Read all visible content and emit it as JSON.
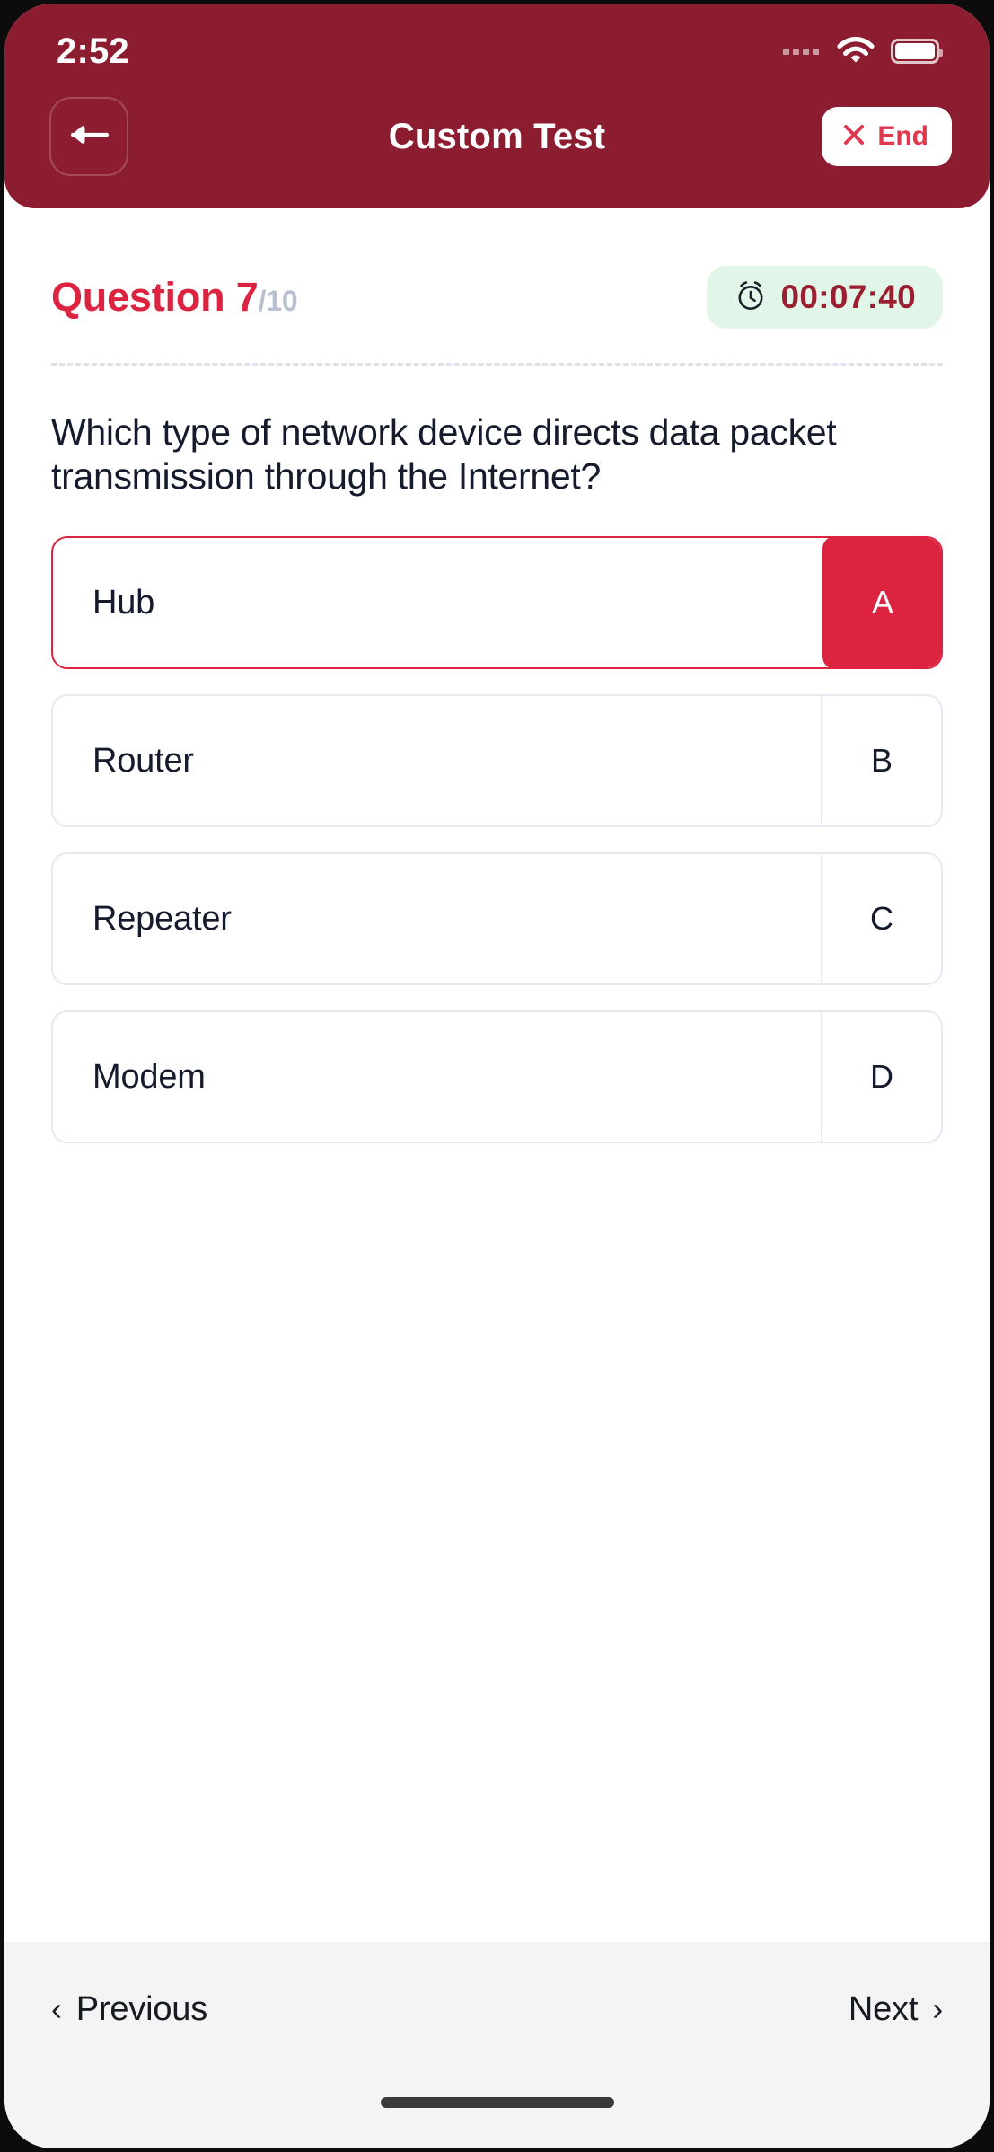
{
  "statusbar": {
    "time": "2:52",
    "signal_icon": "signal-dots-icon",
    "wifi_icon": "wifi-icon",
    "battery_icon": "battery-icon"
  },
  "header": {
    "title": "Custom Test",
    "back_icon": "arrow-left-icon",
    "end_button": {
      "label": "End",
      "icon": "close-x-icon"
    },
    "background_color": "#8c1d30"
  },
  "quiz": {
    "question_label": "Question 7",
    "question_total": "/10",
    "timer": {
      "icon": "alarm-clock-icon",
      "value": "00:07:40",
      "background_color": "#e2f5e9",
      "text_color": "#9b1f30"
    },
    "question_text": "Which type of network device directs data packet transmission through the Internet?",
    "options": [
      {
        "letter": "A",
        "text": "Hub",
        "selected": true
      },
      {
        "letter": "B",
        "text": "Router",
        "selected": false
      },
      {
        "letter": "C",
        "text": "Repeater",
        "selected": false
      },
      {
        "letter": "D",
        "text": "Modem",
        "selected": false
      }
    ],
    "accent_color": "#dc2340"
  },
  "footer": {
    "previous_label": "Previous",
    "previous_icon": "chevron-left-icon",
    "next_label": "Next",
    "next_icon": "chevron-right-icon",
    "home_indicator": "home-indicator"
  }
}
